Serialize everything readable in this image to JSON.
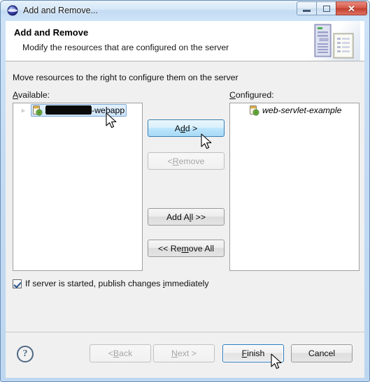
{
  "window": {
    "title": "Add and Remove...",
    "icon": "eclipse-sphere-icon",
    "controls": {
      "minimize": "Minimize",
      "maximize": "Maximize",
      "close": "✕"
    }
  },
  "header": {
    "title": "Add and Remove",
    "subtitle": "Modify the resources that are configured on the server",
    "banner_icon": "server-and-document-icon"
  },
  "body": {
    "instruction": "Move resources to the right to configure them on the server",
    "available": {
      "label_pre": "A",
      "label_accel": "",
      "label": "Available:",
      "label_before": "",
      "label_acc_letter": "A",
      "label_rest": "vailable:",
      "items": [
        {
          "redacted": true,
          "suffix": "-webapp",
          "selected": true,
          "expandable": true,
          "arrow": "▹",
          "icon": "web-module-icon"
        }
      ]
    },
    "configured": {
      "label_acc_letter": "C",
      "label_rest": "onfigured:",
      "items": [
        {
          "redacted": false,
          "name": "web-servlet-example",
          "italic": true,
          "expandable": false,
          "icon": "web-module-icon"
        }
      ]
    },
    "transfer_buttons": [
      {
        "id": "add",
        "pre": "A",
        "acc": "d",
        "post": "d >",
        "state": "hover"
      },
      {
        "id": "remove",
        "pre": "< ",
        "acc": "R",
        "post": "emove",
        "state": "disabled"
      },
      {
        "id": "add-all",
        "pre": "Add A",
        "acc": "l",
        "post": "l >>",
        "state": "normal"
      },
      {
        "id": "remove-all",
        "pre": "<< Re",
        "acc": "m",
        "post": "ove All",
        "state": "normal"
      }
    ],
    "publish_checkbox": {
      "checked": true,
      "text_before": "If server is started, publish changes ",
      "acc_letter": "i",
      "text_after": "mmediately"
    }
  },
  "footer": {
    "help_glyph": "?",
    "buttons": [
      {
        "id": "back",
        "pre": "< ",
        "acc": "B",
        "post": "ack",
        "state": "disabled"
      },
      {
        "id": "next",
        "pre": "",
        "acc": "N",
        "post": "ext >",
        "state": "disabled"
      },
      {
        "id": "finish",
        "pre": "",
        "acc": "F",
        "post": "inish",
        "state": "default"
      },
      {
        "id": "cancel",
        "pre": "",
        "acc": "",
        "post": "Cancel",
        "state": "normal"
      }
    ]
  },
  "colors": {
    "titlebar_top": "#e8f2fb",
    "titlebar_bottom": "#cde3f8",
    "frame_border": "#6d90b8",
    "body_bg": "#f0f0f0",
    "list_bg": "#ffffff",
    "accent_blue": "#3c7fb1",
    "close_red": "#c2402f",
    "selection_blue": "#cfe5fa",
    "focus_ring": "#2d7bbd",
    "redaction_black": "#0a0a0a"
  }
}
